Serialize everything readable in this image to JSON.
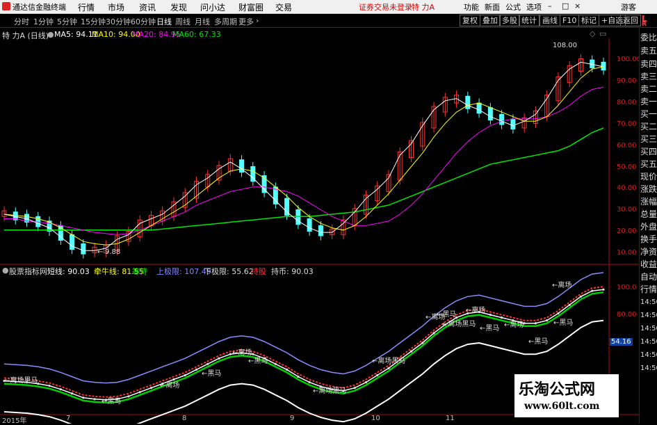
{
  "menubar": {
    "app_title": "通达信金融终端",
    "items": [
      "行情",
      "市场",
      "资讯",
      "发现",
      "问小达",
      "财富圈",
      "交易"
    ],
    "notice": "证券交易未登录",
    "stock_name": "特 力A",
    "right_items": [
      "功能",
      "新面",
      "公式",
      "选项"
    ],
    "guest": "游客"
  },
  "toolbar": {
    "periods": [
      "分时",
      "1分钟",
      "5分钟",
      "15分钟",
      "30分钟",
      "60分钟",
      "日线",
      "周线",
      "月线",
      "多周期",
      "更多"
    ],
    "active_period": "日线",
    "right_buttons": [
      "复权",
      "叠加",
      "多股",
      "统计",
      "画线",
      "F10",
      "标记",
      "+自选",
      "返回"
    ]
  },
  "main_legend": {
    "name": "特 力A (日线)",
    "ma5": "MA5: 94.11",
    "ma10": "MA10: 94.00",
    "ma20": "MA20: 84.95",
    "ma60": "MA60: 67.33"
  },
  "main_annotations": {
    "high": "108.00",
    "low": "9.88"
  },
  "main_axis_labels": [
    "100.00",
    "90.00",
    "80.00",
    "70.00",
    "60.00",
    "50.00",
    "40.00",
    "30.00",
    "20.00",
    "10.00"
  ],
  "indicator_legend": {
    "name": "股票指标网",
    "lines": [
      "短线: 90.03",
      "牵牛线: 81.55",
      "等待",
      "上极限: 107.49",
      "下极限: 55.62",
      "持股",
      "持币: 90.03"
    ]
  },
  "indicator_axis_labels": [
    "100.0",
    "80.00",
    "54.16"
  ],
  "indicator_signals": [
    "←离场",
    "←黑马",
    "←离场",
    "←黑马",
    "←离场",
    "←黑马",
    "←离场黑马",
    "←离场",
    "←离场",
    "←黑马",
    "←黑马",
    "←离场",
    "←黑马",
    "←离场黑马",
    "←离场黑马",
    "←离场黑马",
    "←黑马"
  ],
  "side_panel": {
    "top_labels": [
      "L",
      "R"
    ],
    "items": [
      "委比",
      "卖五",
      "卖四",
      "卖三",
      "卖二",
      "卖一",
      "买一",
      "买二",
      "买三",
      "买四",
      "买五",
      "现价",
      "涨跌",
      "涨幅",
      "总量",
      "外盘",
      "换手",
      "净资",
      "收益",
      "自动",
      "行情",
      "14:50",
      "14:50",
      "14:50",
      "14:50",
      "14:50",
      "14:50"
    ]
  },
  "date_axis": [
    "2015年",
    "7",
    "8",
    "9",
    "10",
    "11"
  ],
  "watermark": {
    "title": "乐淘公式网",
    "url": "www.60lt.com"
  },
  "colors": {
    "up": "#ff3232",
    "down": "#54ffff",
    "ma5": "#ffffff",
    "ma10": "#ffff00",
    "ma20": "#ff00ff",
    "ma60": "#00e600",
    "axis": "#d02020"
  },
  "chart_data": {
    "type": "candlestick",
    "y_range": [
      10,
      105
    ],
    "ma5": [
      29,
      28,
      27,
      25,
      23,
      19,
      15,
      13,
      13,
      14,
      18,
      20,
      25,
      27,
      29,
      33,
      37,
      42,
      45,
      49,
      52,
      49,
      45,
      40,
      35,
      30,
      26,
      23,
      21,
      21,
      25,
      30,
      36,
      40,
      45,
      55,
      60,
      68,
      75,
      79,
      80,
      77,
      75,
      72,
      70,
      68,
      70,
      73,
      80,
      88,
      93,
      96,
      95,
      94
    ],
    "ma10": [
      29,
      28.5,
      28,
      27,
      25.5,
      23,
      20,
      17,
      16,
      15.5,
      16,
      18,
      21,
      24,
      27,
      30,
      33,
      37,
      41,
      45,
      48,
      49,
      48,
      45,
      41,
      37,
      32,
      28,
      25,
      23,
      22,
      24,
      28,
      33,
      38,
      44,
      50,
      56,
      63,
      69,
      74,
      77,
      78,
      76,
      74,
      72,
      70,
      70,
      72,
      77,
      83,
      89,
      93,
      94
    ],
    "ma20": [
      27,
      27,
      26,
      25.5,
      25,
      24,
      23,
      22,
      21,
      20.5,
      20,
      20.5,
      22,
      24,
      26,
      28,
      30,
      33,
      35,
      37,
      39,
      40,
      41,
      41,
      40,
      39,
      37,
      34,
      31,
      28,
      26,
      24,
      24,
      25,
      26,
      29,
      33,
      38,
      44,
      50,
      56,
      61,
      65,
      68,
      70,
      71,
      71,
      71,
      72,
      74,
      77,
      81,
      84,
      85
    ],
    "ma60": [
      22,
      22,
      22,
      22,
      22,
      22,
      22,
      22,
      22,
      22,
      22,
      22,
      22,
      22,
      22.5,
      23,
      23.5,
      24,
      24.5,
      25,
      25.5,
      26,
      26.5,
      27,
      27.5,
      28,
      28,
      28,
      28.5,
      29,
      29.5,
      30,
      31,
      32,
      33,
      35,
      37,
      39,
      41,
      43,
      45,
      47,
      49,
      51,
      52,
      53,
      54,
      55,
      56,
      57,
      59,
      62,
      65,
      67
    ]
  }
}
